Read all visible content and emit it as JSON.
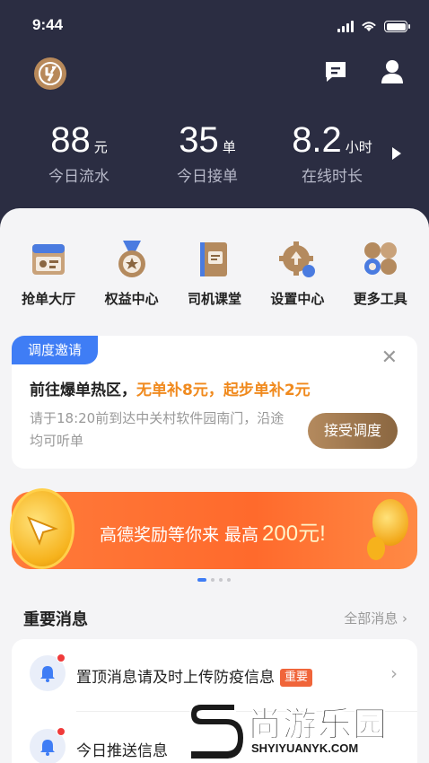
{
  "status_bar": {
    "time": "9:44"
  },
  "stats": [
    {
      "value": "88",
      "unit": "元",
      "label": "今日流水"
    },
    {
      "value": "35",
      "unit": "单",
      "label": "今日接单"
    },
    {
      "value": "8.2",
      "unit": "小时",
      "label": "在线时长"
    }
  ],
  "tools": [
    {
      "label": "抢单大厅",
      "icon": "order-hall-icon"
    },
    {
      "label": "权益中心",
      "icon": "medal-icon"
    },
    {
      "label": "司机课堂",
      "icon": "book-icon"
    },
    {
      "label": "设置中心",
      "icon": "gear-icon"
    },
    {
      "label": "更多工具",
      "icon": "more-tools-icon"
    }
  ],
  "invite": {
    "tag": "调度邀请",
    "title_prefix": "前往爆单热区，",
    "title_highlight": "无单补8元，起步单补2元",
    "description": "请于18:20前到达中关村软件园南门，沿途均可听单",
    "accept_label": "接受调度"
  },
  "banner": {
    "text": "高德奖励等你来 最高",
    "amount": "200元!"
  },
  "carousel": {
    "count": 4,
    "active_index": 0
  },
  "messages": {
    "title": "重要消息",
    "all_label": "全部消息",
    "items": [
      {
        "text": "置顶消息请及时上传防疫信息",
        "badge": "重要"
      },
      {
        "text": "今日推送信息",
        "badge": ""
      }
    ]
  },
  "watermark": {
    "name": "尚游乐园",
    "url": "SHYIYUANYK.COM"
  },
  "colors": {
    "header_bg": "#2b2d42",
    "accent_blue": "#3f7df5",
    "accent_orange": "#f08a1e",
    "gold": "#b48a5e"
  }
}
